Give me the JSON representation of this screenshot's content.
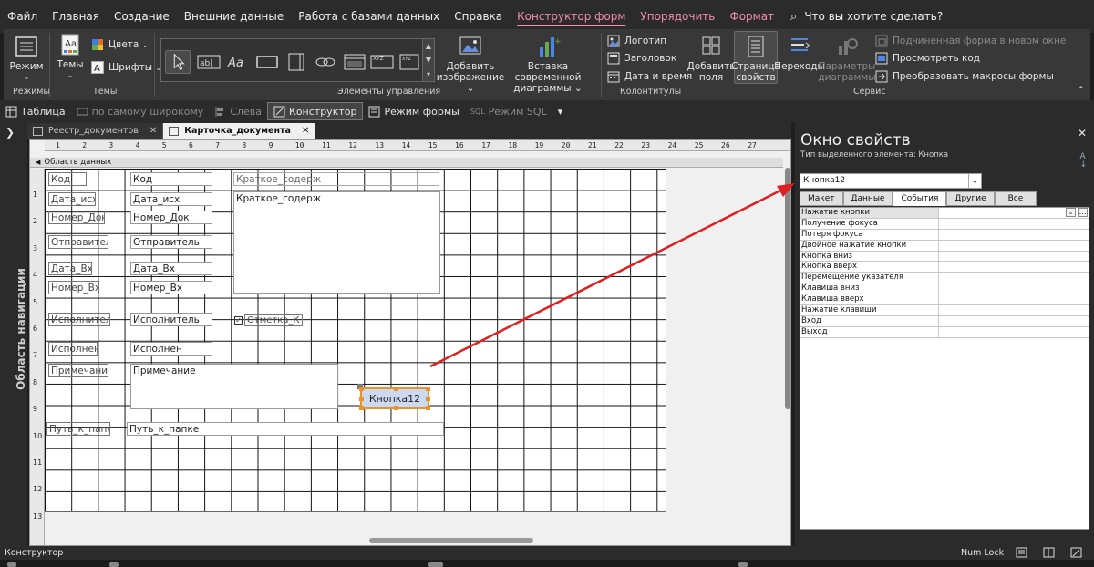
{
  "menu": {
    "items": [
      "Файл",
      "Главная",
      "Создание",
      "Внешние данные",
      "Работа с базами данных",
      "Справка"
    ],
    "active_tab": "Конструктор форм",
    "context_tabs": [
      "Упорядочить",
      "Формат"
    ],
    "tell_me": "Что вы хотите сделать?"
  },
  "ribbon": {
    "mode": "Режим",
    "themes": "Темы",
    "colors": "Цвета",
    "fonts": "Шрифты",
    "add_image_line1": "Добавить",
    "add_image_line2": "изображение",
    "insert_chart_line1": "Вставка современной",
    "insert_chart_line2": "диаграммы",
    "logo": "Логотип",
    "title": "Заголовок",
    "datetime": "Дата и время",
    "add_fields_line1": "Добавить",
    "add_fields_line2": "поля",
    "prop_sheet_line1": "Страница",
    "prop_sheet_line2": "свойств",
    "transitions": "Переходы",
    "diagram_params_line1": "Параметры",
    "diagram_params_line2": "диаграммы",
    "subform_new_window": "Подчиненная форма в новом окне",
    "view_code": "Просмотреть код",
    "convert_macros": "Преобразовать макросы формы",
    "groups": {
      "modes": "Режимы",
      "themes": "Темы",
      "controls": "Элементы управления",
      "header_footer": "Колонтитулы",
      "service": "Сервис"
    }
  },
  "viewbar": {
    "table": "Таблица",
    "widest": "по самому широкому",
    "left": "Слева",
    "designer": "Конструктор",
    "form_mode": "Режим формы",
    "sql_mode": "Режим SQL"
  },
  "nav_pane": {
    "label": "Область навигации"
  },
  "doc_tabs": [
    {
      "label": "Реестр_документов"
    },
    {
      "label": "Карточка_документа"
    }
  ],
  "design": {
    "section_label": "Область данных",
    "ruler_h": [
      "1",
      "2",
      "3",
      "4",
      "5",
      "6",
      "7",
      "8",
      "9",
      "10",
      "11",
      "12",
      "13",
      "14",
      "15",
      "16",
      "17",
      "18",
      "19",
      "20",
      "21",
      "22",
      "23",
      "24",
      "25",
      "26",
      "27"
    ],
    "ruler_v": [
      "1",
      "2",
      "3",
      "4",
      "5",
      "6",
      "7",
      "8",
      "9",
      "10",
      "11",
      "12",
      "13"
    ],
    "labels": {
      "kod": "Код",
      "data_isx": "Дата_исх",
      "nomer_dok": "Номер_Док",
      "otpravitel": "Отправитель",
      "data_vx": "Дата_Вх",
      "nomer_vx": "Номер_Вх",
      "ispolnitel": "Исполнитель",
      "ispolnen": "Исполнен",
      "primechanie": "Примечание",
      "put": "Путь_к_папке",
      "kratkoe": "Краткое_содерж",
      "otmetka": "Отметка_К"
    },
    "fields": {
      "kod": "Код",
      "data_isx": "Дата_исх",
      "nomer_dok": "Номер_Док",
      "otpravitel": "Отправитель",
      "data_vx": "Дата_Вх",
      "nomer_vx": "Номер_Вх",
      "ispolnitel": "Исполнитель",
      "ispolnen": "Исполнен",
      "primechanie": "Примечание",
      "put": "Путь_к_папке",
      "kratkoe": "Краткое_содерж"
    },
    "button": "Кнопка12"
  },
  "property_sheet": {
    "title": "Окно свойств",
    "selection_type": "Тип выделенного элемента:  Кнопка",
    "selected_object": "Кнопка12",
    "tabs": [
      "Макет",
      "Данные",
      "События",
      "Другие",
      "Все"
    ],
    "active_tab": "События",
    "properties": [
      "Нажатие кнопки",
      "Получение фокуса",
      "Потеря фокуса",
      "Двойное нажатие кнопки",
      "Кнопка вниз",
      "Кнопка вверх",
      "Перемещение указателя",
      "Клавиша вниз",
      "Клавиша вверх",
      "Нажатие клавиши",
      "Вход",
      "Выход"
    ]
  },
  "status": {
    "mode": "Конструктор",
    "num_lock": "Num Lock"
  },
  "colors": {
    "accent": "#f08bb0",
    "arrow": "#e02020",
    "selection": "#e5932a"
  }
}
